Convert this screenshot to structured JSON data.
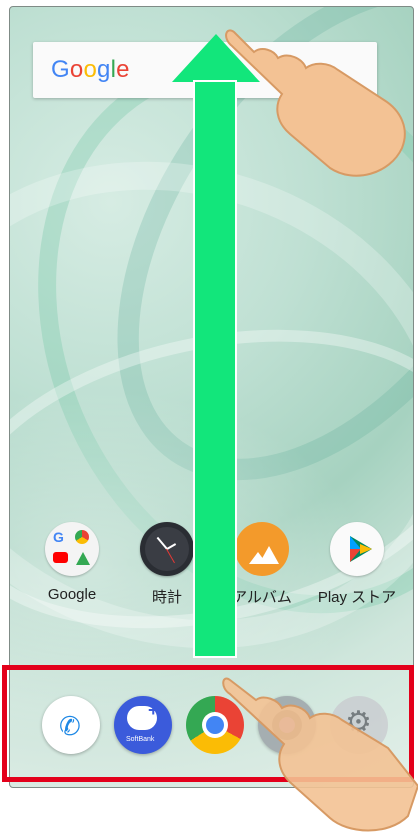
{
  "search_bar": {
    "logo_text": "Google"
  },
  "apps": [
    {
      "label": "Google",
      "icon": "google-folder-icon"
    },
    {
      "label": "時計",
      "icon": "clock-icon"
    },
    {
      "label": "アルバム",
      "icon": "album-icon"
    },
    {
      "label": "Play ストア",
      "icon": "play-store-icon"
    }
  ],
  "dock": [
    {
      "icon": "phone-icon"
    },
    {
      "icon": "softbank-messenger-icon",
      "caption": "SoftBank"
    },
    {
      "icon": "chrome-icon"
    },
    {
      "icon": "camera-icon"
    },
    {
      "icon": "settings-icon"
    }
  ],
  "gesture": {
    "direction": "up",
    "arrow_color": "#12e67b",
    "highlight_color": "#e3001b"
  }
}
